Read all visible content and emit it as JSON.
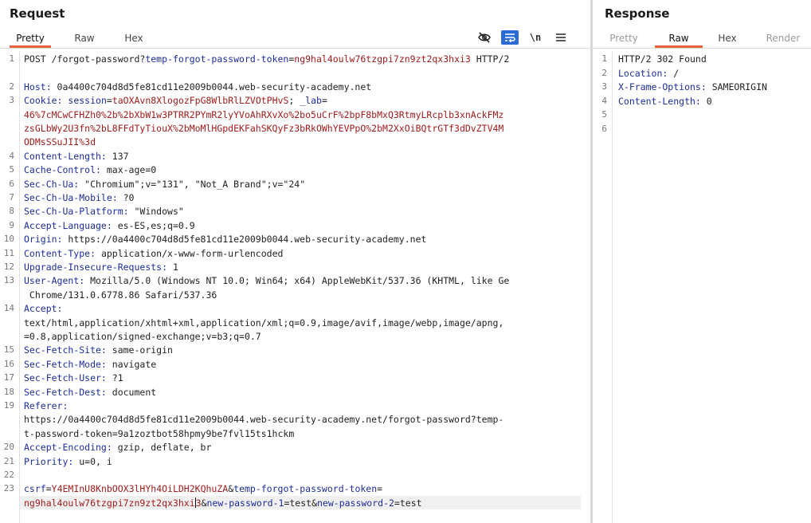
{
  "request": {
    "title": "Request",
    "tabs": [
      "Pretty",
      "Raw",
      "Hex"
    ],
    "active_tab": "Pretty",
    "tools": {
      "wrap_label": "\\n"
    },
    "lines": [
      {
        "n": "1",
        "parts": [
          {
            "t": "POST /forgot-password?",
            "c": "v"
          },
          {
            "t": "temp-forgot-password-token",
            "c": "k"
          },
          {
            "t": "=",
            "c": "v"
          },
          {
            "t": "ng9hal4oulw76tzgpi7zn9zt2qx3hxi3",
            "c": "r"
          },
          {
            "t": " HTTP/2",
            "c": "v"
          }
        ]
      },
      {
        "n": "2",
        "parts": [
          {
            "t": "Host:",
            "c": "k"
          },
          {
            "t": " 0a4400c704d8d5fe81cd11e2009b0044.web-security-academy.net",
            "c": "v"
          }
        ]
      },
      {
        "n": "3",
        "parts": [
          {
            "t": "Cookie:",
            "c": "k"
          },
          {
            "t": " ",
            "c": "v"
          },
          {
            "t": "session",
            "c": "k"
          },
          {
            "t": "=",
            "c": "v"
          },
          {
            "t": "taOXAvn8XlogozFpG8WlbRlLZVOtPHvS",
            "c": "r"
          },
          {
            "t": "; ",
            "c": "v"
          },
          {
            "t": "_lab",
            "c": "k"
          },
          {
            "t": "=",
            "c": "v"
          }
        ]
      },
      {
        "n": "",
        "parts": [
          {
            "t": "46%7cMCwCFHZh0%2b%2bXbW1w3PTRR2PYmR2lyYVoAhRXvXo%2bo5uCrF%2bpF8bMxQ3RtmyLRcplb3xnAckFMz",
            "c": "r"
          }
        ]
      },
      {
        "n": "",
        "parts": [
          {
            "t": "zsGLbWy2U3fn%2bL8FFdTyTiouX%2bMoMlHGpdEKFahSKQyFz3bRkOWhYEVPpO%2bM2XxOiBQtrGTf3dDvZTV4M",
            "c": "r"
          }
        ]
      },
      {
        "n": "",
        "parts": [
          {
            "t": "ODMsSSuJII%3d",
            "c": "r"
          }
        ]
      },
      {
        "n": "4",
        "parts": [
          {
            "t": "Content-Length:",
            "c": "k"
          },
          {
            "t": " 137",
            "c": "v"
          }
        ]
      },
      {
        "n": "5",
        "parts": [
          {
            "t": "Cache-Control:",
            "c": "k"
          },
          {
            "t": " max-age=0",
            "c": "v"
          }
        ]
      },
      {
        "n": "6",
        "parts": [
          {
            "t": "Sec-Ch-Ua:",
            "c": "k"
          },
          {
            "t": " \"Chromium\";v=\"131\", \"Not_A Brand\";v=\"24\"",
            "c": "v"
          }
        ]
      },
      {
        "n": "7",
        "parts": [
          {
            "t": "Sec-Ch-Ua-Mobile:",
            "c": "k"
          },
          {
            "t": " ?0",
            "c": "v"
          }
        ]
      },
      {
        "n": "8",
        "parts": [
          {
            "t": "Sec-Ch-Ua-Platform:",
            "c": "k"
          },
          {
            "t": " \"Windows\"",
            "c": "v"
          }
        ]
      },
      {
        "n": "9",
        "parts": [
          {
            "t": "Accept-Language:",
            "c": "k"
          },
          {
            "t": " es-ES,es;q=0.9",
            "c": "v"
          }
        ]
      },
      {
        "n": "10",
        "parts": [
          {
            "t": "Origin:",
            "c": "k"
          },
          {
            "t": " https://0a4400c704d8d5fe81cd11e2009b0044.web-security-academy.net",
            "c": "v"
          }
        ]
      },
      {
        "n": "11",
        "parts": [
          {
            "t": "Content-Type:",
            "c": "k"
          },
          {
            "t": " application/x-www-form-urlencoded",
            "c": "v"
          }
        ]
      },
      {
        "n": "12",
        "parts": [
          {
            "t": "Upgrade-Insecure-Requests:",
            "c": "k"
          },
          {
            "t": " 1",
            "c": "v"
          }
        ]
      },
      {
        "n": "13",
        "parts": [
          {
            "t": "User-Agent:",
            "c": "k"
          },
          {
            "t": " Mozilla/5.0 (Windows NT 10.0; Win64; x64) AppleWebKit/537.36 (KHTML, like Ge",
            "c": "v"
          }
        ]
      },
      {
        "n": "",
        "parts": [
          {
            "t": " Chrome/131.0.6778.86 Safari/537.36",
            "c": "v"
          }
        ]
      },
      {
        "n": "14",
        "parts": [
          {
            "t": "Accept:",
            "c": "k"
          }
        ]
      },
      {
        "n": "",
        "parts": [
          {
            "t": "text/html,application/xhtml+xml,application/xml;q=0.9,image/avif,image/webp,image/apng,",
            "c": "v"
          }
        ]
      },
      {
        "n": "",
        "parts": [
          {
            "t": "=0.8,application/signed-exchange;v=b3;q=0.7",
            "c": "v"
          }
        ]
      },
      {
        "n": "15",
        "parts": [
          {
            "t": "Sec-Fetch-Site:",
            "c": "k"
          },
          {
            "t": " same-origin",
            "c": "v"
          }
        ]
      },
      {
        "n": "16",
        "parts": [
          {
            "t": "Sec-Fetch-Mode:",
            "c": "k"
          },
          {
            "t": " navigate",
            "c": "v"
          }
        ]
      },
      {
        "n": "17",
        "parts": [
          {
            "t": "Sec-Fetch-User:",
            "c": "k"
          },
          {
            "t": " ?1",
            "c": "v"
          }
        ]
      },
      {
        "n": "18",
        "parts": [
          {
            "t": "Sec-Fetch-Dest:",
            "c": "k"
          },
          {
            "t": " document",
            "c": "v"
          }
        ]
      },
      {
        "n": "19",
        "parts": [
          {
            "t": "Referer:",
            "c": "k"
          }
        ]
      },
      {
        "n": "",
        "parts": [
          {
            "t": "https://0a4400c704d8d5fe81cd11e2009b0044.web-security-academy.net/forgot-password?temp-",
            "c": "v"
          }
        ]
      },
      {
        "n": "",
        "parts": [
          {
            "t": "t-password-token=9a1zoztbot58hpmy9be7fvl15ts1hckm",
            "c": "v"
          }
        ]
      },
      {
        "n": "20",
        "parts": [
          {
            "t": "Accept-Encoding:",
            "c": "k"
          },
          {
            "t": " gzip, deflate, br",
            "c": "v"
          }
        ]
      },
      {
        "n": "21",
        "parts": [
          {
            "t": "Priority:",
            "c": "k"
          },
          {
            "t": " u=0, i",
            "c": "v"
          }
        ]
      },
      {
        "n": "22",
        "parts": []
      },
      {
        "n": "23",
        "parts": [
          {
            "t": "csrf",
            "c": "k"
          },
          {
            "t": "=",
            "c": "v"
          },
          {
            "t": "Y4EMInU8KnbOOX3lHYh4OiLDH2KQhuZA",
            "c": "r"
          },
          {
            "t": "&",
            "c": "v"
          },
          {
            "t": "temp-forgot-password-token",
            "c": "k"
          },
          {
            "t": "=",
            "c": "v"
          }
        ]
      },
      {
        "n": "",
        "cursor": true,
        "parts": [
          {
            "t": "ng9hal4oulw76tzgpi7zn9zt2qx3hxi",
            "c": "r"
          },
          {
            "t": "|",
            "c": "caret"
          },
          {
            "t": "3",
            "c": "r"
          },
          {
            "t": "&",
            "c": "v"
          },
          {
            "t": "new-password-1",
            "c": "k"
          },
          {
            "t": "=test&",
            "c": "v"
          },
          {
            "t": "new-password-2",
            "c": "k"
          },
          {
            "t": "=test",
            "c": "v"
          }
        ]
      }
    ]
  },
  "response": {
    "title": "Response",
    "tabs": [
      "Pretty",
      "Raw",
      "Hex",
      "Render"
    ],
    "active_tab": "Raw",
    "lines": [
      {
        "n": "1",
        "parts": [
          {
            "t": "HTTP/2 302 Found",
            "c": "v"
          }
        ]
      },
      {
        "n": "2",
        "parts": [
          {
            "t": "Location:",
            "c": "k"
          },
          {
            "t": " /",
            "c": "v"
          }
        ]
      },
      {
        "n": "3",
        "parts": [
          {
            "t": "X-Frame-Options:",
            "c": "k"
          },
          {
            "t": " SAMEORIGIN",
            "c": "v"
          }
        ]
      },
      {
        "n": "4",
        "parts": [
          {
            "t": "Content-Length:",
            "c": "k"
          },
          {
            "t": " 0",
            "c": "v"
          }
        ]
      },
      {
        "n": "5",
        "parts": []
      },
      {
        "n": "6",
        "parts": []
      }
    ]
  },
  "colors": {
    "accent": "#e8633a",
    "key": "#1c2d9c",
    "value": "#a01c1c",
    "tool_active": "#2b6bd4"
  }
}
